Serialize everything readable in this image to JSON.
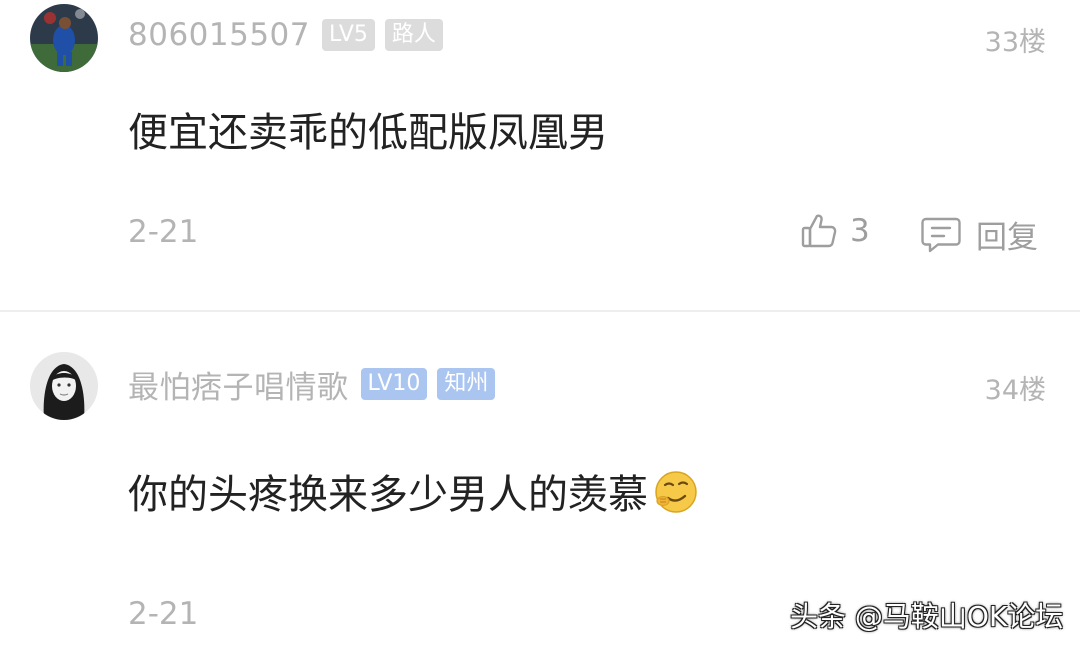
{
  "comments": [
    {
      "username": "806015507",
      "level": "LV5",
      "tag": "路人",
      "floor": "33楼",
      "text": "便宜还卖乖的低配版凤凰男",
      "date": "2-21",
      "likes": "3",
      "reply_label": "回复",
      "avatar_icon": "avatar-football-player",
      "level_color": "#dcdcdc",
      "tag_color": "#dcdcdc"
    },
    {
      "username": "最怕痞子唱情歌",
      "level": "LV10",
      "tag": "知州",
      "floor": "34楼",
      "text": "你的头疼换来多少男人的羡慕",
      "emoji_icon": "smirk-emoji-icon",
      "date": "2-21",
      "avatar_icon": "avatar-portrait-bw",
      "level_color": "#a9c5f0",
      "tag_color": "#a9c5f0"
    }
  ],
  "watermark": "头条 @马鞍山OK论坛"
}
